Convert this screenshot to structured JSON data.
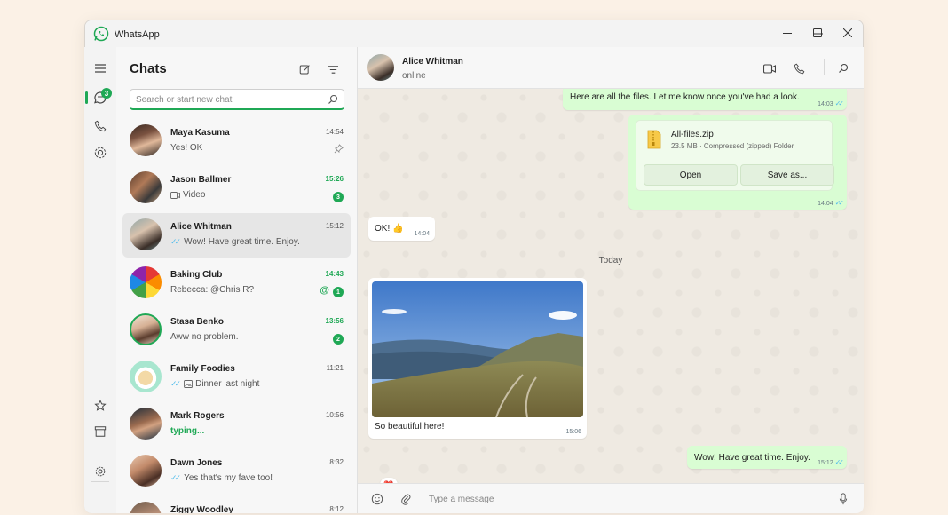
{
  "app": {
    "title": "WhatsApp"
  },
  "rail": {
    "chats_badge": "3"
  },
  "panel": {
    "title": "Chats",
    "search_placeholder": "Search or start new chat"
  },
  "chats": [
    {
      "name": "Maya Kasuma",
      "time": "14:54",
      "preview": "Yes! OK",
      "pinned": true
    },
    {
      "name": "Jason Ballmer",
      "time": "15:26",
      "preview": "Video",
      "unread": "3"
    },
    {
      "name": "Alice Whitman",
      "time": "15:12",
      "preview": "Wow! Have great time. Enjoy."
    },
    {
      "name": "Baking Club",
      "time": "14:43",
      "preview": "Rebecca: @Chris R?",
      "mention": "@",
      "unread": "1"
    },
    {
      "name": "Stasa Benko",
      "time": "13:56",
      "preview": "Aww no problem.",
      "unread": "2"
    },
    {
      "name": "Family Foodies",
      "time": "11:21",
      "preview": "Dinner last night"
    },
    {
      "name": "Mark Rogers",
      "time": "10:56",
      "preview": "typing..."
    },
    {
      "name": "Dawn Jones",
      "time": "8:32",
      "preview": "Yes that's my fave too!"
    },
    {
      "name": "Ziggy Woodley",
      "time": "8:12",
      "preview": ""
    }
  ],
  "conversation": {
    "contact_name": "Alice Whitman",
    "status": "online",
    "messages": {
      "m1": {
        "text": "Here are all the files. Let me know once you've had a look.",
        "time": "14:03"
      },
      "file": {
        "name": "All-files.zip",
        "meta": "23.5 MB · Compressed (zipped) Folder",
        "open_label": "Open",
        "save_label": "Save as...",
        "time": "14:04"
      },
      "m3": {
        "text": "OK! 👍",
        "time": "14:04"
      },
      "day_separator": "Today",
      "photo": {
        "caption": "So beautiful here!",
        "time": "15:06",
        "reaction": "❤️"
      },
      "m5": {
        "text": "Wow! Have great time. Enjoy.",
        "time": "15:12"
      }
    },
    "composer_placeholder": "Type a message"
  }
}
